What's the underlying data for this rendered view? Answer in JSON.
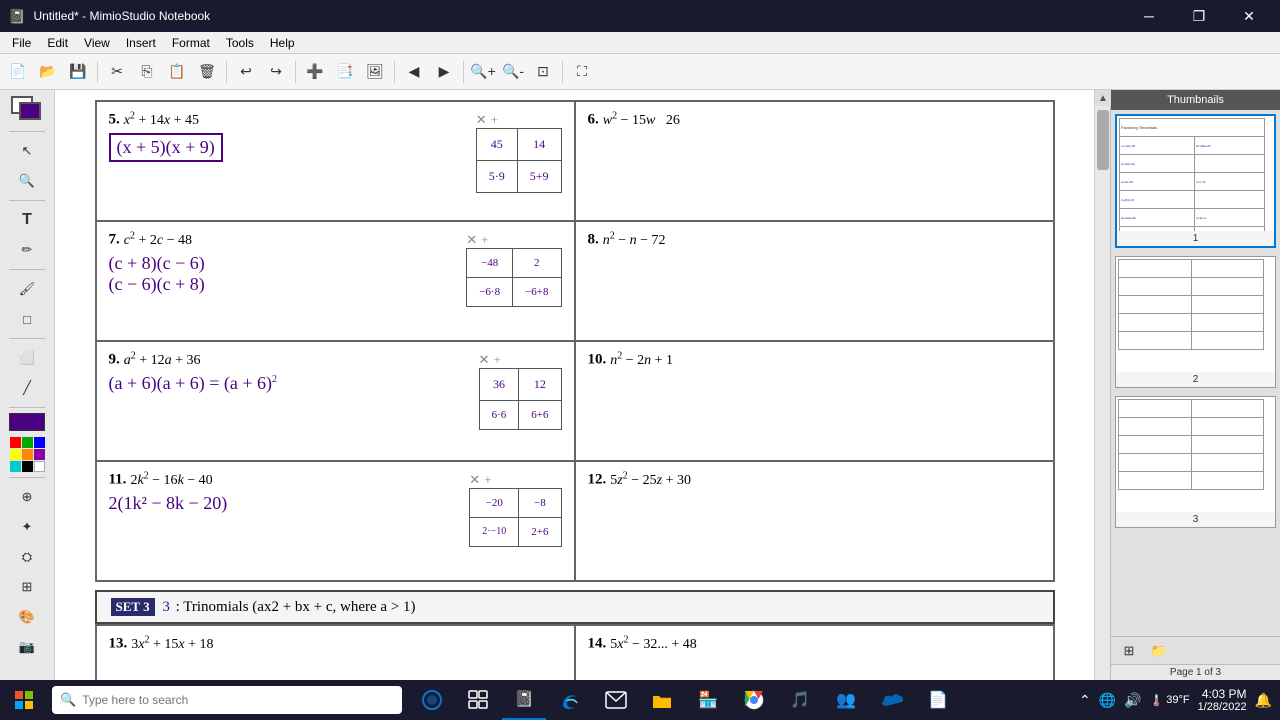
{
  "window": {
    "title": "Untitled* - MimioStudio Notebook"
  },
  "menubar": {
    "items": [
      "File",
      "Edit",
      "View",
      "Insert",
      "Format",
      "Tools",
      "Help"
    ]
  },
  "thumbnails": {
    "header": "Thumbnails",
    "pages": [
      {
        "number": "1"
      },
      {
        "number": "2"
      },
      {
        "number": "3"
      }
    ]
  },
  "problems": {
    "p5": {
      "num": "5.",
      "expr": "x² + 14x + 45",
      "answer": "(x + 5)(x + 9)",
      "diagram_top": "+",
      "diagram_cross": "×",
      "diagram_tl": "45",
      "diagram_tr": "14",
      "diagram_bl": "5·9",
      "diagram_br": "5+9"
    },
    "p6": {
      "num": "6.",
      "expr": "w² − 15w  26"
    },
    "p7": {
      "num": "7.",
      "expr": "c² + 2c − 48",
      "answer1": "(c + 8)(c − 6)",
      "answer2": "(c − 6)(c + 8)",
      "diagram_top": "+",
      "diagram_cross": "×",
      "diagram_tl": "−48",
      "diagram_tr": "2",
      "diagram_bl": "−6·8",
      "diagram_br": "−6+8"
    },
    "p8": {
      "num": "8.",
      "expr": "n² − n − 72"
    },
    "p9": {
      "num": "9.",
      "expr": "a² + 12a + 36",
      "answer": "(a + 6)(a + 6) = (a + 6)²",
      "diagram_top": "+",
      "diagram_cross": "×",
      "diagram_tl": "36",
      "diagram_tr": "12",
      "diagram_bl": "6·6",
      "diagram_br": "6+6"
    },
    "p10": {
      "num": "10.",
      "expr": "n² − 2n + 1"
    },
    "p11": {
      "num": "11.",
      "expr": "2k² − 16k − 40",
      "answer1": "2(1k² − 8k − 20)",
      "diagram_top": "+",
      "diagram_cross": "×",
      "diagram_tl": "−20",
      "diagram_tr": "−8",
      "diagram_bl": "2·−10",
      "diagram_br": "2+6"
    },
    "p12": {
      "num": "12.",
      "expr": "5z² − 25z + 30"
    },
    "set3": {
      "label": "SET 3",
      "num": "3",
      "text": ": Trinomials (ax2 + bx + c, where a > 1)"
    },
    "p13": {
      "num": "13.",
      "expr": "3x² + 15x + 18"
    },
    "p14": {
      "num": "14.",
      "expr": "5x² − 32 ... + 48"
    }
  },
  "taskbar": {
    "search_placeholder": "Type here to search",
    "time": "4:03 PM",
    "date": "1/28/2022",
    "page_info": "Page 1 of 3",
    "weather": "39°F"
  }
}
